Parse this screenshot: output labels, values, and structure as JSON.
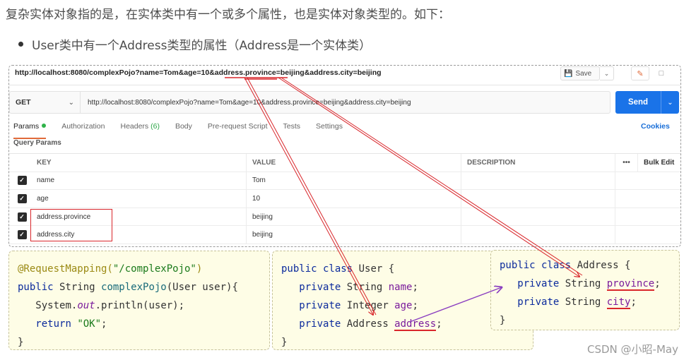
{
  "intro": "复杂实体对象指的是，在实体类中有一个或多个属性，也是实体对象类型的。如下：",
  "bullet": "User类中有一个Address类型的属性（Address是一个实体类）",
  "postman": {
    "request_title": "http://localhost:8080/complexPojo?name=Tom&age=10&address.province=beijing&address.city=beijing",
    "save_label": "Save",
    "method": "GET",
    "url": "http://localhost:8080/complexPojo?name=Tom&age=10&address.province=beijing&address.city=beijing",
    "send_label": "Send",
    "tabs": {
      "params": "Params",
      "authorization": "Authorization",
      "headers": "Headers",
      "headers_count": "(6)",
      "body": "Body",
      "prerequest": "Pre-request Script",
      "tests": "Tests",
      "settings": "Settings"
    },
    "cookies_label": "Cookies",
    "query_params_title": "Query Params",
    "table": {
      "headers": {
        "key": "KEY",
        "value": "VALUE",
        "description": "DESCRIPTION",
        "more": "•••",
        "bulk_edit": "Bulk Edit"
      },
      "rows": [
        {
          "key": "name",
          "value": "Tom",
          "checked": true
        },
        {
          "key": "age",
          "value": "10",
          "checked": true
        },
        {
          "key": "address.province",
          "value": "beijing",
          "checked": true
        },
        {
          "key": "address.city",
          "value": "beijing",
          "checked": true
        }
      ]
    }
  },
  "code_controller": {
    "l1_ann": "@RequestMapping(",
    "l1_str": "\"/complexPojo\"",
    "l1_end": ")",
    "l2_kw": "public",
    "l2_type": " String ",
    "l2_fn": "complexPojo",
    "l2_rest": "(User user){",
    "l3_a": "System.",
    "l3_out": "out",
    "l3_b": ".println(user);",
    "l4_kw": "return ",
    "l4_str": "\"OK\"",
    "l4_end": ";",
    "l5": "}"
  },
  "code_user": {
    "l1_kw": "public class",
    "l1_rest": " User {",
    "l2_kw": "private",
    "l2_type": " String ",
    "l2_field": "name",
    "l2_end": ";",
    "l3_kw": "private",
    "l3_type": " Integer ",
    "l3_field": "age",
    "l3_end": ";",
    "l4_kw": "private",
    "l4_type": " Address ",
    "l4_field": "address",
    "l4_end": ";",
    "l5": "}"
  },
  "code_address": {
    "l1_kw": "public class",
    "l1_rest": " Address {",
    "l2_kw": "private",
    "l2_type": " String ",
    "l2_field": "province",
    "l2_end": ";",
    "l3_kw": "private",
    "l3_type": " String ",
    "l3_field": "city",
    "l3_end": ";",
    "l4": "}"
  },
  "watermark": "CSDN @小昭-May",
  "colors": {
    "send": "#1a73e8",
    "annotation_red": "#d9262b",
    "arrow_purple": "#8a3ec0",
    "code_bg": "#fefde6"
  }
}
